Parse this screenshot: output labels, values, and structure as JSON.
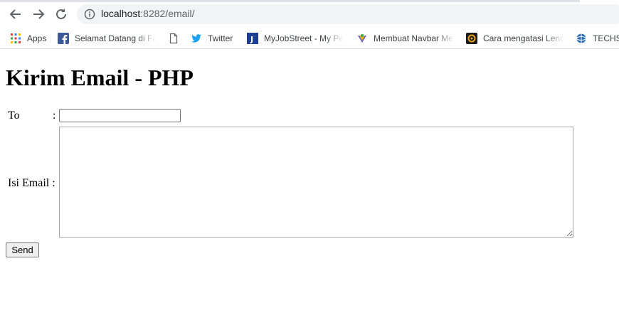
{
  "browser": {
    "url_host": "localhost",
    "url_rest": ":8282/email/"
  },
  "bookmarks": [
    {
      "label": "Apps",
      "icon": "apps-grid-icon"
    },
    {
      "label": "Selamat Datang di Fa",
      "icon": "facebook-icon"
    },
    {
      "label": "",
      "icon": "page-icon"
    },
    {
      "label": "Twitter",
      "icon": "twitter-icon"
    },
    {
      "label": "MyJobStreet - My Pe",
      "icon": "jobstreet-icon"
    },
    {
      "label": "Membuat Navbar Me",
      "icon": "site-icon"
    },
    {
      "label": "Cara mengatasi Leno",
      "icon": "site-icon"
    },
    {
      "label": "TECHSA",
      "icon": "globe-icon"
    }
  ],
  "page": {
    "title": "Kirim Email - PHP",
    "to_label": "To",
    "to_colon": ":",
    "to_value": "",
    "message_label": "Isi Email :",
    "message_value": "",
    "send_label": "Send"
  }
}
